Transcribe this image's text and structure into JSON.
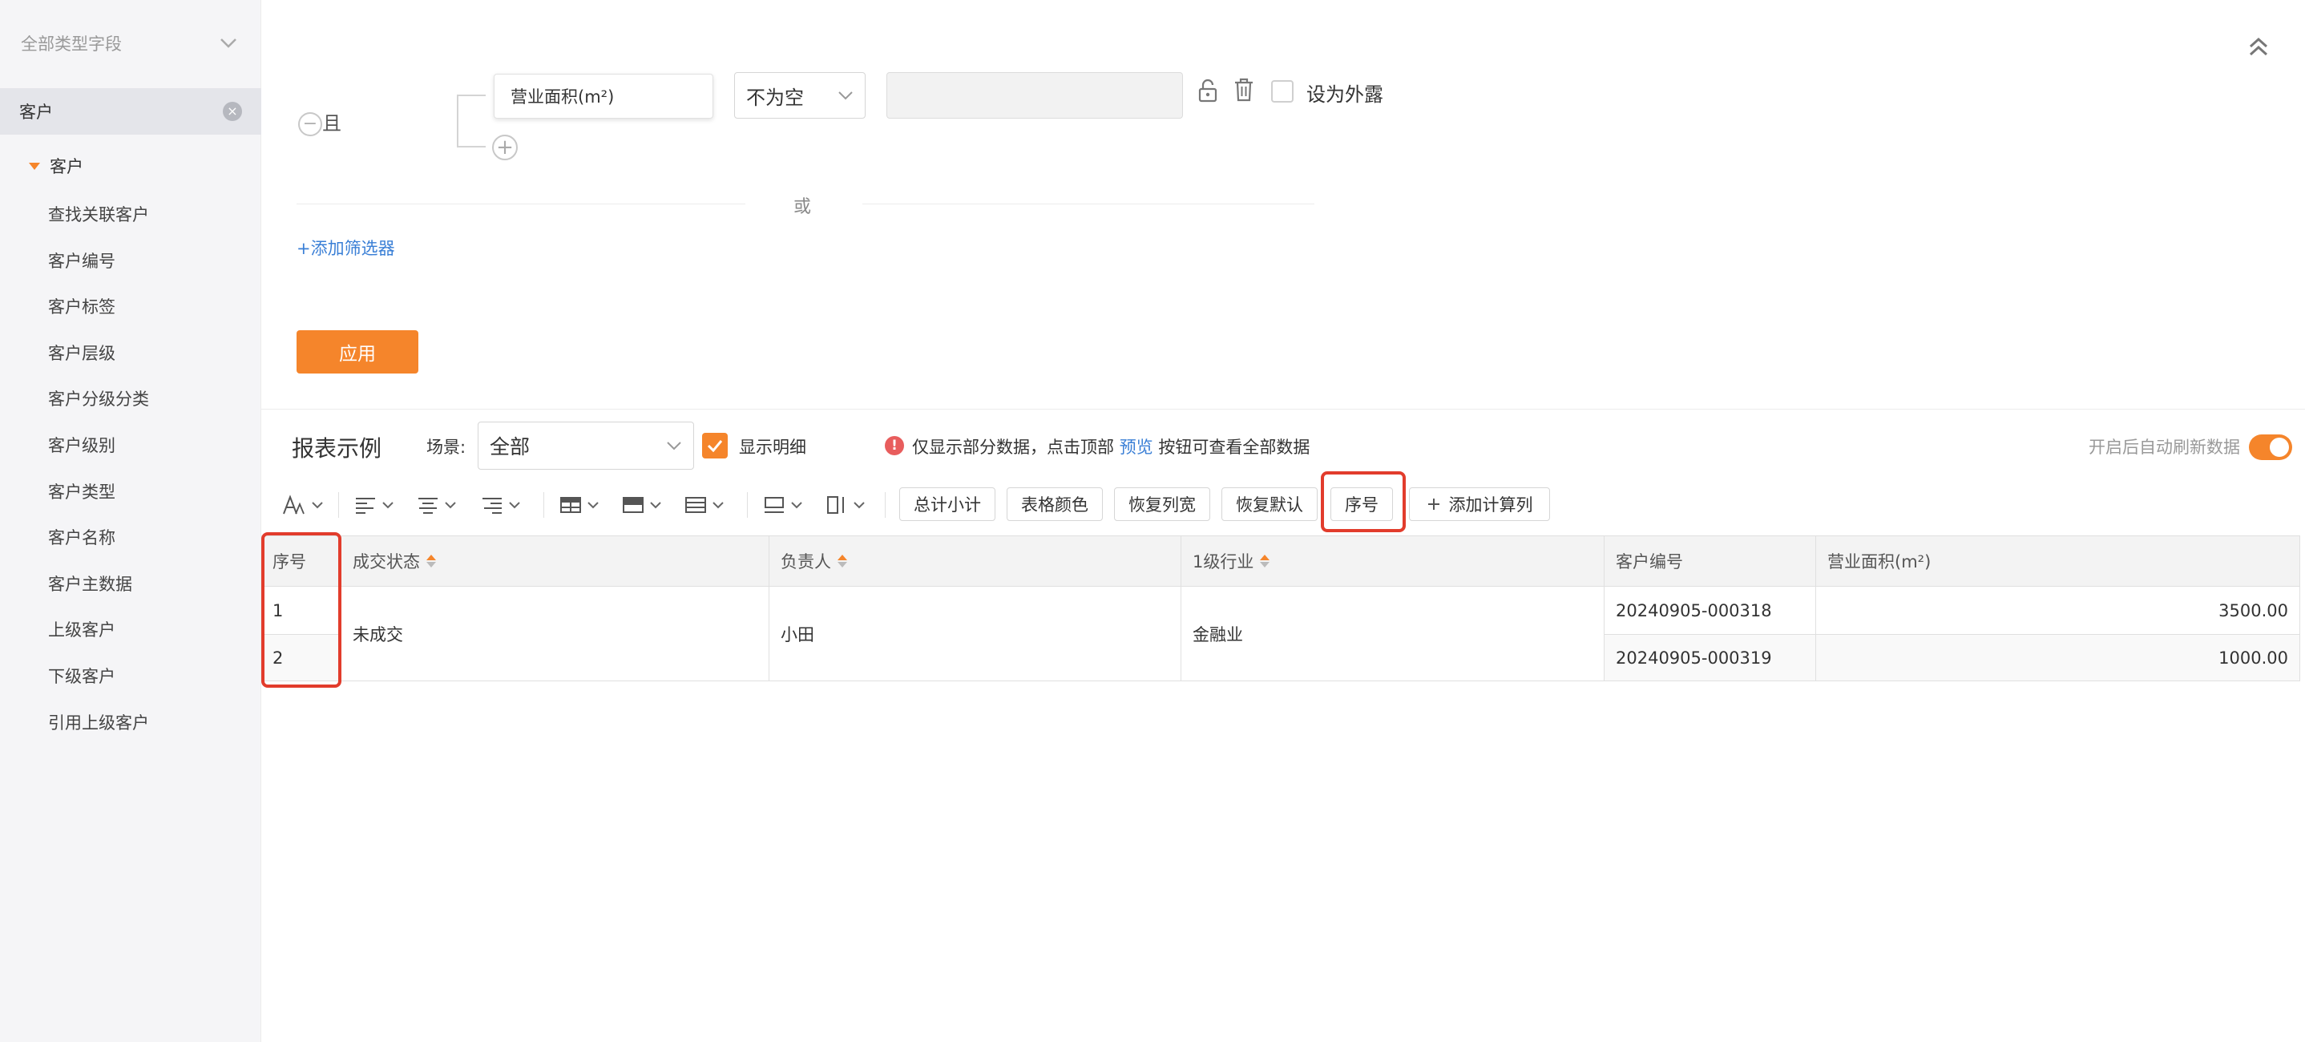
{
  "sidebar": {
    "type_select": "全部类型字段",
    "selected_tag": "客户",
    "tree_root": "客户",
    "items": [
      "查找关联客户",
      "客户编号",
      "客户标签",
      "客户层级",
      "客户分级分类",
      "客户级别",
      "客户类型",
      "客户名称",
      "客户主数据",
      "上级客户",
      "下级客户",
      "引用上级客户"
    ]
  },
  "filter": {
    "and_label": "且",
    "field": "营业面积(m²)",
    "operator": "不为空",
    "value": "",
    "expose_label": "设为外露",
    "or_label": "或",
    "add_filter": "+添加筛选器",
    "apply": "应用"
  },
  "report": {
    "title": "报表示例",
    "scene_label": "场景:",
    "scene_value": "全部",
    "show_detail": "显示明细",
    "show_detail_checked": true,
    "notice_prefix": "仅显示部分数据，点击顶部",
    "notice_link": "预览",
    "notice_suffix": "按钮可查看全部数据",
    "auto_refresh": "开启后自动刷新数据",
    "auto_refresh_on": true
  },
  "toolbar": {
    "subtotal": "总计小计",
    "table_color": "表格颜色",
    "reset_width": "恢复列宽",
    "reset_default": "恢复默认",
    "serial": "序号",
    "add_calc": "添加计算列"
  },
  "table": {
    "headers": {
      "serial": "序号",
      "deal_status": "成交状态",
      "owner": "负责人",
      "industry": "1级行业",
      "customer_no": "客户编号",
      "area": "营业面积(m²)"
    },
    "merged": {
      "deal_status": "未成交",
      "owner": "小田",
      "industry": "金融业"
    },
    "rows": [
      {
        "serial": "1",
        "customer_no": "20240905-000318",
        "area": "3500.00"
      },
      {
        "serial": "2",
        "customer_no": "20240905-000319",
        "area": "1000.00"
      }
    ]
  },
  "colors": {
    "accent": "#f5852b",
    "link": "#3a7fd6",
    "highlight": "#e23c2c"
  }
}
